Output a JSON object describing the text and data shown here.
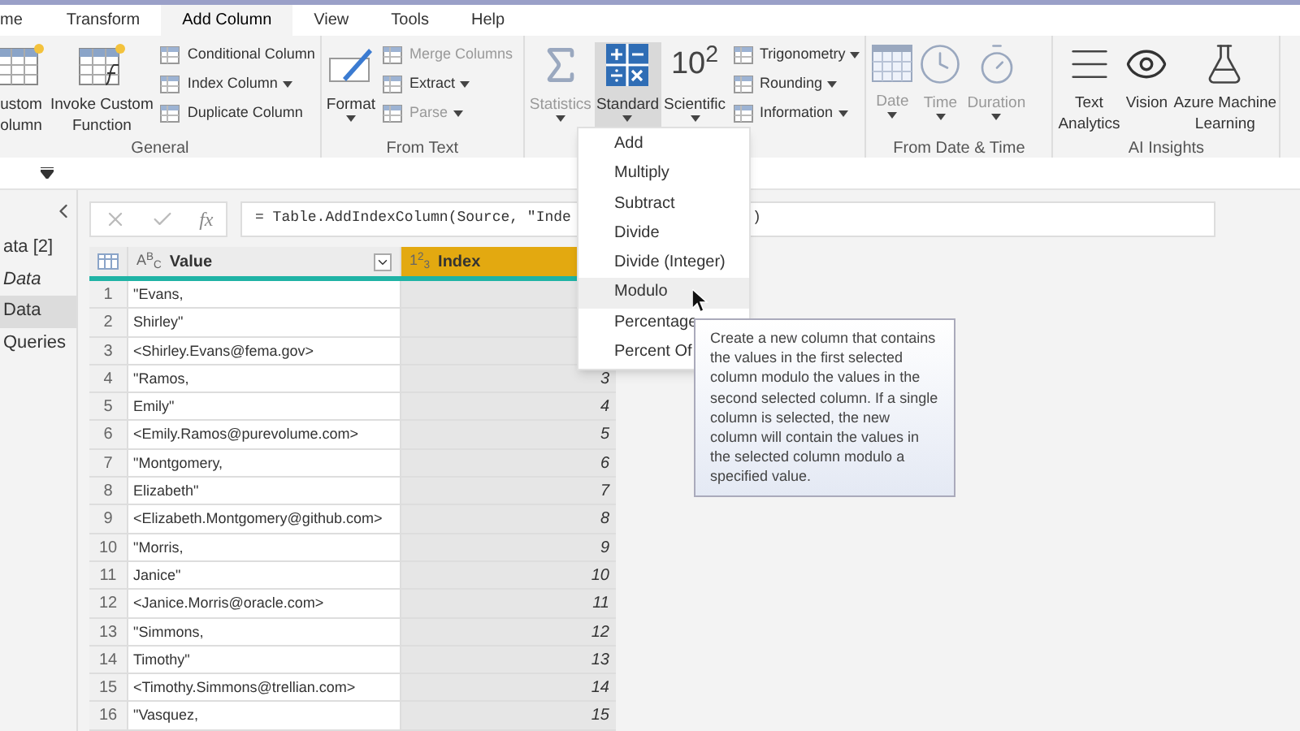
{
  "tabs": [
    {
      "label": "me",
      "selected": false
    },
    {
      "label": "Transform",
      "selected": false
    },
    {
      "label": "Add Column",
      "selected": true
    },
    {
      "label": "View",
      "selected": false
    },
    {
      "label": "Tools",
      "selected": false
    },
    {
      "label": "Help",
      "selected": false
    }
  ],
  "ribbon": {
    "groups": [
      {
        "label": "General",
        "large": [
          {
            "label": "ustom\nolumn",
            "disabled": false,
            "has_menu": false,
            "selected": false
          },
          {
            "label": "Invoke Custom\nFunction",
            "disabled": false,
            "has_menu": false,
            "selected": false
          }
        ],
        "small": [
          {
            "label": "Conditional Column",
            "disabled": false,
            "has_menu": false
          },
          {
            "label": "Index Column",
            "disabled": false,
            "has_menu": true
          },
          {
            "label": "Duplicate Column",
            "disabled": false,
            "has_menu": false
          }
        ]
      },
      {
        "label": "From Text",
        "large": [
          {
            "label": "Format",
            "disabled": false,
            "has_menu": true,
            "selected": false
          }
        ],
        "small": [
          {
            "label": "Merge Columns",
            "disabled": true,
            "has_menu": false
          },
          {
            "label": "Extract",
            "disabled": false,
            "has_menu": true
          },
          {
            "label": "Parse",
            "disabled": true,
            "has_menu": true
          }
        ]
      },
      {
        "large": [
          {
            "label": "Statistics",
            "disabled": true,
            "has_menu": true,
            "selected": false
          },
          {
            "label": "Standard",
            "disabled": false,
            "has_menu": true,
            "selected": true
          },
          {
            "label": "Scientific",
            "glyph": "10$^{2}$",
            "disabled": false,
            "has_menu": true,
            "selected": false
          }
        ],
        "small": [
          {
            "label": "Trigonometry",
            "disabled": false,
            "has_menu": true
          },
          {
            "label": "Rounding",
            "disabled": false,
            "has_menu": true
          },
          {
            "label": "Information",
            "disabled": false,
            "has_menu": true
          }
        ]
      },
      {
        "label": "From Date & Time",
        "large": [
          {
            "label": "Date",
            "disabled": true,
            "has_menu": true,
            "selected": false
          },
          {
            "label": "Time",
            "disabled": true,
            "has_menu": true,
            "selected": false
          },
          {
            "label": "Duration",
            "disabled": true,
            "has_menu": true,
            "selected": false
          }
        ]
      },
      {
        "label": "AI Insights",
        "large": [
          {
            "label": "Text\nAnalytics",
            "disabled": false,
            "has_menu": false,
            "selected": false
          },
          {
            "label": "Vision",
            "disabled": false,
            "has_menu": false,
            "selected": false
          },
          {
            "label": "Azure Machine\nLearning",
            "disabled": false,
            "has_menu": false,
            "selected": false
          }
        ]
      }
    ]
  },
  "queries": {
    "items": [
      {
        "label": "ata [2]",
        "italic": false,
        "selected": false
      },
      {
        "label": "Data",
        "italic": true,
        "selected": false
      },
      {
        "label": "Data",
        "italic": false,
        "selected": true
      },
      {
        "label": "Queries",
        "italic": false,
        "selected": false
      }
    ]
  },
  "formula_bar": {
    "fx": "fx",
    "formula": "= Table.AddIndexColumn(Source, \"Inde",
    "formula_end": ")"
  },
  "table": {
    "columns": [
      {
        "type": "A$^{B}$$_{C}$",
        "label": "Value",
        "selected": false
      },
      {
        "type": "1$^{2}$$_{3}$",
        "label": "Index",
        "selected": true
      }
    ],
    "rows": [
      {
        "num": "1",
        "value": "\"Evans,"
      },
      {
        "num": "2",
        "value": "Shirley\""
      },
      {
        "num": "3",
        "value": "<Shirley.Evans@fema.gov>"
      },
      {
        "num": "4",
        "value": "\"Ramos,",
        "index": "3"
      },
      {
        "num": "5",
        "value": "Emily\"",
        "index": "4"
      },
      {
        "num": "6",
        "value": "<Emily.Ramos@purevolume.com>",
        "index": "5"
      },
      {
        "num": "7",
        "value": "\"Montgomery,",
        "index": "6"
      },
      {
        "num": "8",
        "value": "Elizabeth\"",
        "index": "7"
      },
      {
        "num": "9",
        "value": "<Elizabeth.Montgomery@github.com>",
        "index": "8"
      },
      {
        "num": "10",
        "value": "\"Morris,",
        "index": "9"
      },
      {
        "num": "11",
        "value": "Janice\"",
        "index": "10"
      },
      {
        "num": "12",
        "value": "<Janice.Morris@oracle.com>",
        "index": "11"
      },
      {
        "num": "13",
        "value": "\"Simmons,",
        "index": "12"
      },
      {
        "num": "14",
        "value": "Timothy\"",
        "index": "13"
      },
      {
        "num": "15",
        "value": "<Timothy.Simmons@trellian.com>",
        "index": "14"
      },
      {
        "num": "16",
        "value": "\"Vasquez,",
        "index": "15"
      }
    ]
  },
  "menu": {
    "items": [
      {
        "label": "Add",
        "selected": false
      },
      {
        "label": "Multiply",
        "selected": false
      },
      {
        "label": "Subtract",
        "selected": false
      },
      {
        "label": "Divide",
        "selected": false
      },
      {
        "label": "Divide (Integer)",
        "selected": false
      },
      {
        "label": "Modulo",
        "selected": true
      },
      {
        "label": "Percentage",
        "selected": false
      },
      {
        "label": "Percent Of",
        "selected": false
      }
    ]
  },
  "tooltip": {
    "text": "Create a new column that contains the values in the first selected column modulo the values in the second selected column. If a single column is selected, the new column will contain the values in the selected column modulo a specified value."
  }
}
